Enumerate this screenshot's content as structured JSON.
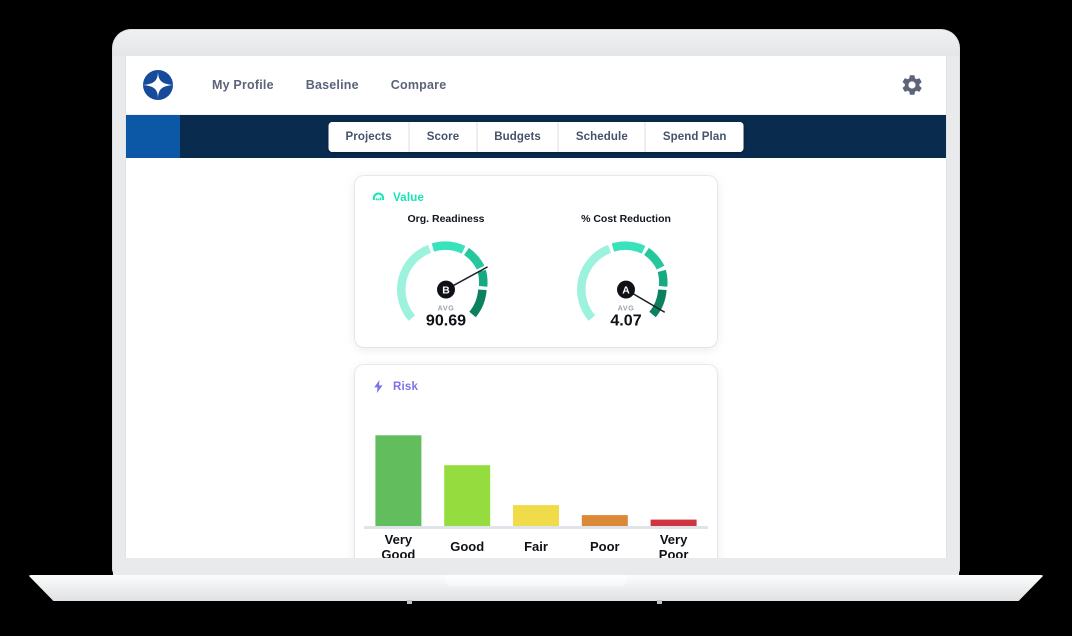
{
  "app": {
    "logo_icon": "compass-rose-logo",
    "brand_color": "#0f4a9c"
  },
  "topnav": {
    "items": [
      {
        "label": "My Profile",
        "name": "my-profile"
      },
      {
        "label": "Baseline",
        "name": "baseline"
      },
      {
        "label": "Compare",
        "name": "compare"
      }
    ],
    "settings_icon": "gear-icon"
  },
  "tabs": {
    "items": [
      {
        "label": "Projects"
      },
      {
        "label": "Score"
      },
      {
        "label": "Budgets"
      },
      {
        "label": "Schedule"
      },
      {
        "label": "Spend Plan"
      }
    ],
    "bar_color": "#092b4d",
    "accent_color": "#0d57a7"
  },
  "value_card": {
    "icon": "gauge-dashboard-icon",
    "title": "Value",
    "title_color": "#17e6b4",
    "gauges": [
      {
        "label": "Org. Readiness",
        "grade": "B",
        "avg_label": "AVG",
        "avg_value": "90.69",
        "needle_angle_deg": 62
      },
      {
        "label": "% Cost Reduction",
        "grade": "A",
        "avg_label": "AVG",
        "avg_value": "4.07",
        "needle_angle_deg": 118
      }
    ],
    "segment_colors": [
      "#9cf2dd",
      "#38e2ba",
      "#27c79d",
      "#17a982",
      "#0c8160"
    ]
  },
  "risk_card": {
    "icon": "lightning-bolt-icon",
    "title": "Risk",
    "title_color": "#7b72e9"
  },
  "chart_data": {
    "type": "bar",
    "title": "Risk",
    "xlabel": "",
    "ylabel": "",
    "categories": [
      "Very Good",
      "Good",
      "Fair",
      "Poor",
      "Very Poor"
    ],
    "values": [
      100,
      67,
      23,
      12,
      7
    ],
    "ylim": [
      0,
      108
    ],
    "grid": false,
    "legend": "none",
    "colors": [
      "#62bd5c",
      "#95dc3f",
      "#f0dc4a",
      "#db8837",
      "#cf3441"
    ],
    "axis_line_color": "#dfe3ea"
  }
}
